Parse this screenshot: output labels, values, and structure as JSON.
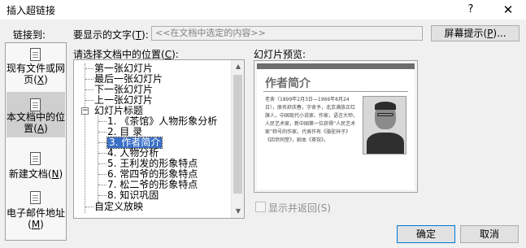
{
  "dialog": {
    "title": "插入超链接",
    "help_glyph": "?",
    "close_glyph": "✕"
  },
  "link_to": {
    "label": "链接到:",
    "items": [
      {
        "label": "现有文件或网页(",
        "key": "X",
        "suffix": ")"
      },
      {
        "label": "本文档中的位置(",
        "key": "A",
        "suffix": ")"
      },
      {
        "label": "新建文档(",
        "key": "N",
        "suffix": ")"
      },
      {
        "label": "电子邮件地址(",
        "key": "M",
        "suffix": ")"
      }
    ]
  },
  "display_text": {
    "label": "要显示的文字(",
    "key": "T",
    "suffix": "):",
    "value": "<<在文档中选定的内容>>"
  },
  "screentip_button": {
    "label": "屏幕提示(",
    "key": "P",
    "suffix": ")..."
  },
  "location": {
    "label": "请选择文档中的位置(",
    "key": "C",
    "suffix": "):",
    "tree": [
      {
        "text": "第一张幻灯片"
      },
      {
        "text": "最后一张幻灯片"
      },
      {
        "text": "下一张幻灯片"
      },
      {
        "text": "上一张幻灯片"
      },
      {
        "text": "幻灯片标题",
        "expander": "−"
      },
      {
        "text": "1. 《茶馆》人物形象分析"
      },
      {
        "text": "2. 目 录"
      },
      {
        "text": "3. 作者简介",
        "selected": true
      },
      {
        "text": "4. 人物分析"
      },
      {
        "text": "5. 王利发的形象特点"
      },
      {
        "text": "6. 常四爷的形象特点"
      },
      {
        "text": "7. 松二爷的形象特点"
      },
      {
        "text": "8. 知识巩固"
      },
      {
        "text": "自定义放映"
      }
    ]
  },
  "preview": {
    "label": "幻灯片预览:",
    "slide_title": "作者简介",
    "slide_body": "老舍（1899年2月3日—1966年8月24日），原名舒庆春，字舍予，北京满族正红旗人，中国现代小说家、作家，语言大师，人民艺术家，新中国第一位获得“人民艺术家”称号的作家。代表作有《骆驼祥子》《四世同堂》，剧本《茶馆》。"
  },
  "show_and_return": {
    "label": "显示并返回(S)",
    "checked": false
  },
  "buttons": {
    "ok": "确定",
    "cancel": "取消"
  },
  "scrollbar": {
    "up_glyph": "▲",
    "down_glyph": "▼"
  }
}
